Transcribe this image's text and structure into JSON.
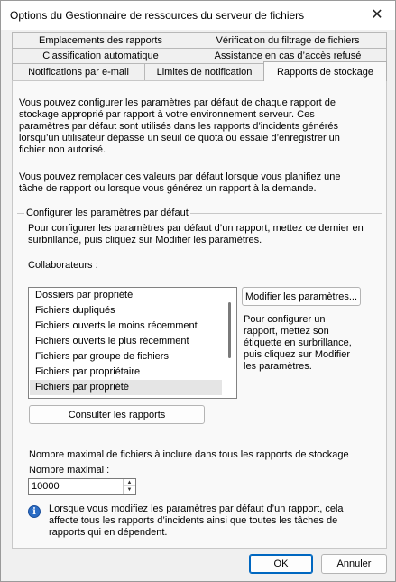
{
  "window": {
    "title": "Options du Gestionnaire de ressources du serveur de fichiers",
    "close_glyph": "✕"
  },
  "tabs": {
    "row1": [
      "Emplacements des rapports",
      "Vérification du filtrage de fichiers"
    ],
    "row2": [
      "Classification automatique",
      "Assistance en cas d’accès refusé"
    ],
    "row3": [
      "Notifications par e-mail",
      "Limites de notification",
      "Rapports de stockage"
    ],
    "active": "Rapports de stockage"
  },
  "intro": {
    "para1": [
      "Vous pouvez configurer les paramètres par défaut de chaque rapport de",
      "stockage approprié par rapport à votre environnement serveur. Ces",
      "paramètres par défaut sont utilisés dans les rapports d’incidents générés",
      "lorsqu’un utilisateur dépasse un seuil de quota ou essaie d’enregistrer un",
      "fichier non autorisé."
    ],
    "para2": [
      "Vous pouvez remplacer ces valeurs par défaut lorsque vous planifiez une",
      "tâche de rapport ou lorsque vous générez un rapport à la demande."
    ]
  },
  "group": {
    "legend": "Configurer les paramètres par défaut",
    "instructions": [
      "Pour configurer les paramètres par défaut d’un rapport, mettez ce dernier en",
      "surbrillance, puis cliquez sur Modifier les paramètres."
    ],
    "list_label": "Collaborateurs :",
    "reports": [
      "Dossiers par propriété",
      "Fichiers dupliqués",
      "Fichiers ouverts le moins récemment",
      "Fichiers ouverts le plus récemment",
      "Fichiers par groupe de fichiers",
      "Fichiers par propriétaire",
      "Fichiers par propriété"
    ],
    "selected_report": "Fichiers par propriété",
    "edit_button": "Modifier les paramètres...",
    "edit_help": [
      "Pour configurer un",
      "rapport, mettez son",
      "étiquette en surbrillance,",
      "puis cliquez sur Modifier",
      "les paramètres."
    ],
    "view_button": "Consulter les rapports",
    "max_files_label": "Nombre maximal de fichiers à inclure dans tous les rapports de stockage",
    "max_label": "Nombre maximal :",
    "max_value": "10000",
    "info_icon": "info-icon",
    "info_text": [
      "Lorsque vous modifiez les paramètres par défaut d’un rapport, cela",
      "affecte tous les rapports d’incidents ainsi que toutes les tâches de",
      "rapports qui en dépendent."
    ]
  },
  "footer": {
    "ok": "OK",
    "cancel": "Annuler"
  },
  "colors": {
    "accent": "#0067c0",
    "info_icon": "#2b6cc4",
    "selection": "#e5e5e5"
  }
}
